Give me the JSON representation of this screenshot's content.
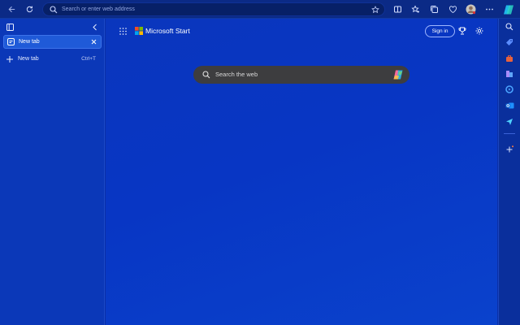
{
  "browser": {
    "address_placeholder": "Search or enter web address"
  },
  "tabs_pane": {
    "tabs": [
      {
        "label": "New tab",
        "active": true
      }
    ],
    "new_tab": {
      "label": "New tab",
      "shortcut": "Ctrl+T"
    }
  },
  "page": {
    "brand": "Microsoft Start",
    "sign_in": "Sign in",
    "search_placeholder": "Search the web"
  },
  "colors": {
    "accent": "#1f5ad8",
    "background": "#0a36bd"
  }
}
